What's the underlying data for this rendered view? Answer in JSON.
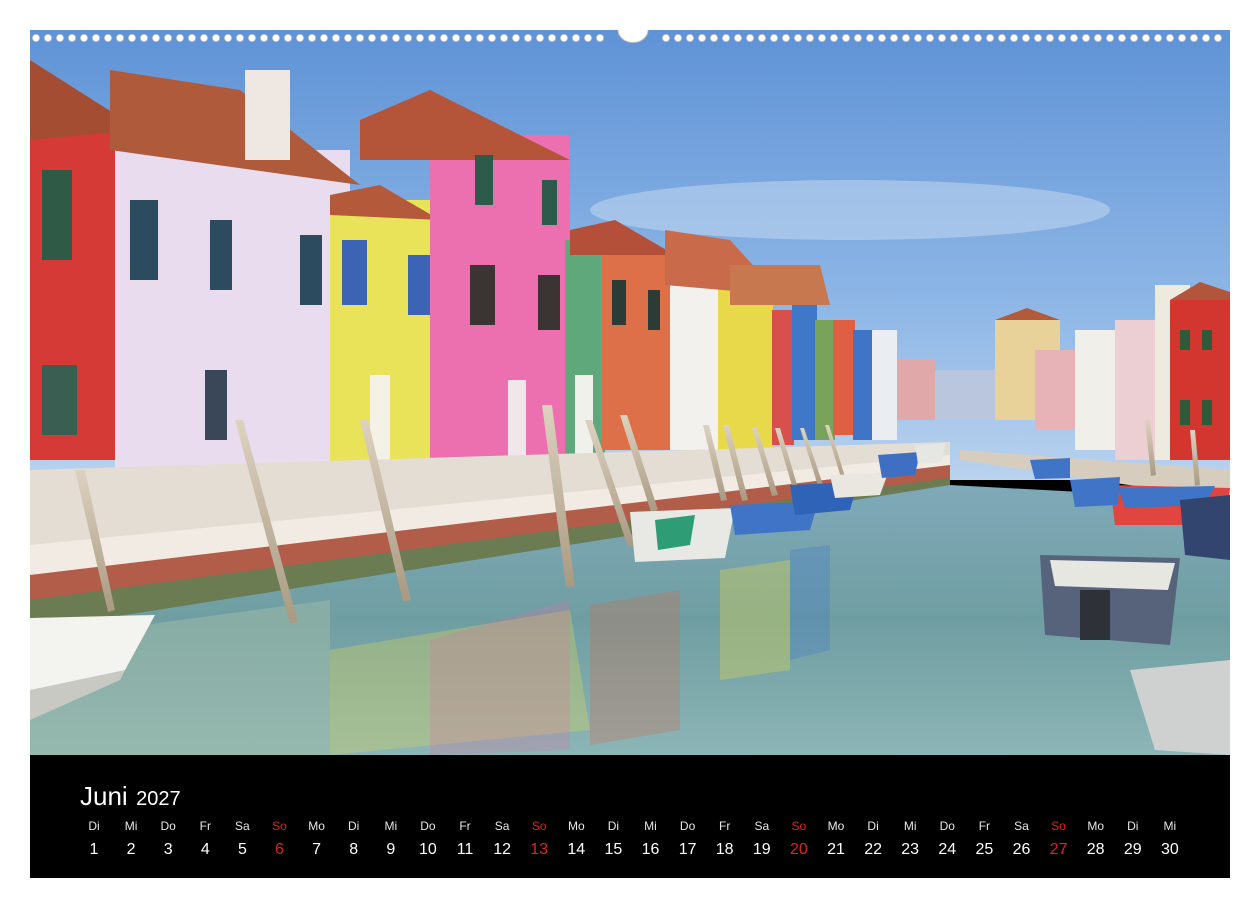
{
  "calendar": {
    "month": "Juni",
    "year": "2027",
    "sunday_color": "#e2231a",
    "days": [
      {
        "wd": "Di",
        "d": "1"
      },
      {
        "wd": "Mi",
        "d": "2"
      },
      {
        "wd": "Do",
        "d": "3"
      },
      {
        "wd": "Fr",
        "d": "4"
      },
      {
        "wd": "Sa",
        "d": "5"
      },
      {
        "wd": "So",
        "d": "6",
        "sunday": true
      },
      {
        "wd": "Mo",
        "d": "7"
      },
      {
        "wd": "Di",
        "d": "8"
      },
      {
        "wd": "Mi",
        "d": "9"
      },
      {
        "wd": "Do",
        "d": "10"
      },
      {
        "wd": "Fr",
        "d": "11"
      },
      {
        "wd": "Sa",
        "d": "12"
      },
      {
        "wd": "So",
        "d": "13",
        "sunday": true
      },
      {
        "wd": "Mo",
        "d": "14"
      },
      {
        "wd": "Di",
        "d": "15"
      },
      {
        "wd": "Mi",
        "d": "16"
      },
      {
        "wd": "Do",
        "d": "17"
      },
      {
        "wd": "Fr",
        "d": "18"
      },
      {
        "wd": "Sa",
        "d": "19"
      },
      {
        "wd": "So",
        "d": "20",
        "sunday": true
      },
      {
        "wd": "Mo",
        "d": "21"
      },
      {
        "wd": "Di",
        "d": "22"
      },
      {
        "wd": "Mi",
        "d": "23"
      },
      {
        "wd": "Do",
        "d": "24"
      },
      {
        "wd": "Fr",
        "d": "25"
      },
      {
        "wd": "Sa",
        "d": "26"
      },
      {
        "wd": "So",
        "d": "27",
        "sunday": true
      },
      {
        "wd": "Mo",
        "d": "28"
      },
      {
        "wd": "Di",
        "d": "29"
      },
      {
        "wd": "Mi",
        "d": "30"
      }
    ]
  }
}
